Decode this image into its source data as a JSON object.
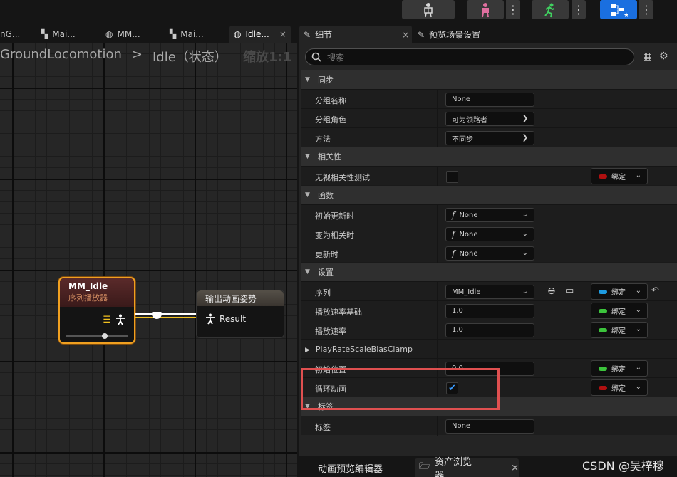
{
  "toolbar": {
    "buttons": [
      {
        "icon": "skeleton-icon"
      },
      {
        "icon": "mesh-icon"
      },
      {
        "icon": "run-animation-icon"
      },
      {
        "icon": "blueprint-icon"
      }
    ]
  },
  "editor_tabs": [
    {
      "label": "nG..."
    },
    {
      "label": "Mai..."
    },
    {
      "label": "MM..."
    },
    {
      "label": "Mai..."
    },
    {
      "label": "Idle...",
      "close": "×"
    }
  ],
  "graph": {
    "breadcrumb": {
      "root": "GroundLocomotion",
      "sep": ">",
      "current": "Idle（状态）"
    },
    "zoom": "缩放1:1",
    "seq_node": {
      "title": "MM_Idle",
      "subtitle": "序列播放器"
    },
    "out_node": {
      "title": "输出动画姿势",
      "pin": "Result"
    }
  },
  "details": {
    "tab_details": "细节",
    "tab_details_close": "×",
    "tab_preview": "预览场景设置",
    "search_placeholder": "搜索",
    "categories": {
      "sync": "同步",
      "relevancy": "相关性",
      "functions": "函数",
      "settings": "设置",
      "tags": "标签"
    },
    "rows": {
      "group_name": {
        "label": "分组名称",
        "value": "None"
      },
      "group_role": {
        "label": "分组角色",
        "value": "可为领路者"
      },
      "method": {
        "label": "方法",
        "value": "不同步"
      },
      "ignore_relevancy": {
        "label": "无视相关性测试"
      },
      "on_initial_update": {
        "label": "初始更新时",
        "value": "None"
      },
      "on_become_relevant": {
        "label": "变为相关时",
        "value": "None"
      },
      "on_update": {
        "label": "更新时",
        "value": "None"
      },
      "sequence": {
        "label": "序列",
        "value": "MM_Idle"
      },
      "play_rate_basis": {
        "label": "播放速率基础",
        "value": "1.0"
      },
      "play_rate": {
        "label": "播放速率",
        "value": "1.0"
      },
      "clamp": {
        "label": "PlayRateScaleBiasClamp"
      },
      "start_position": {
        "label": "初始位置",
        "value": "0.0"
      },
      "loop_animation": {
        "label": "循环动画",
        "checked": true
      },
      "tag": {
        "label": "标签",
        "value": "None"
      }
    },
    "bind_label": "绑定",
    "bind_colors": {
      "red": "#b01010",
      "blue": "#1e9be0",
      "green": "#3cc43c"
    }
  },
  "bottom_tabs": {
    "anim_preview": "动画预览编辑器",
    "asset_browser": "资产浏览器",
    "close": "×"
  },
  "watermark": "CSDN @吴梓穆"
}
